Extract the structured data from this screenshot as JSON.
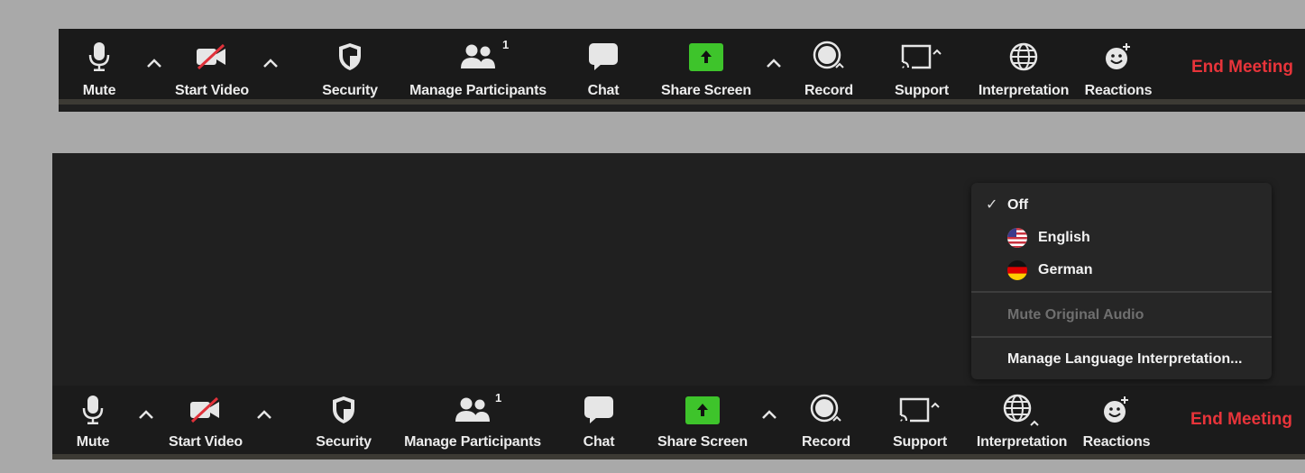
{
  "toolbar": {
    "mute": "Mute",
    "start_video": "Start Video",
    "security": "Security",
    "manage_participants": "Manage Participants",
    "participants_count": "1",
    "chat": "Chat",
    "share_screen": "Share Screen",
    "record": "Record",
    "support": "Support",
    "interpretation": "Interpretation",
    "reactions": "Reactions",
    "end_meeting": "End Meeting"
  },
  "interpretation_menu": {
    "off": "Off",
    "off_checked": true,
    "languages": [
      {
        "label": "English",
        "flag": "us-flag-icon"
      },
      {
        "label": "German",
        "flag": "germany-flag-icon"
      }
    ],
    "mute_original_audio": "Mute Original Audio",
    "manage": "Manage Language Interpretation..."
  },
  "colors": {
    "end_meeting": "#e8343a",
    "share_screen": "#3ec42b",
    "toolbar_bg": "#1a1a1a",
    "menu_bg": "#262626"
  }
}
